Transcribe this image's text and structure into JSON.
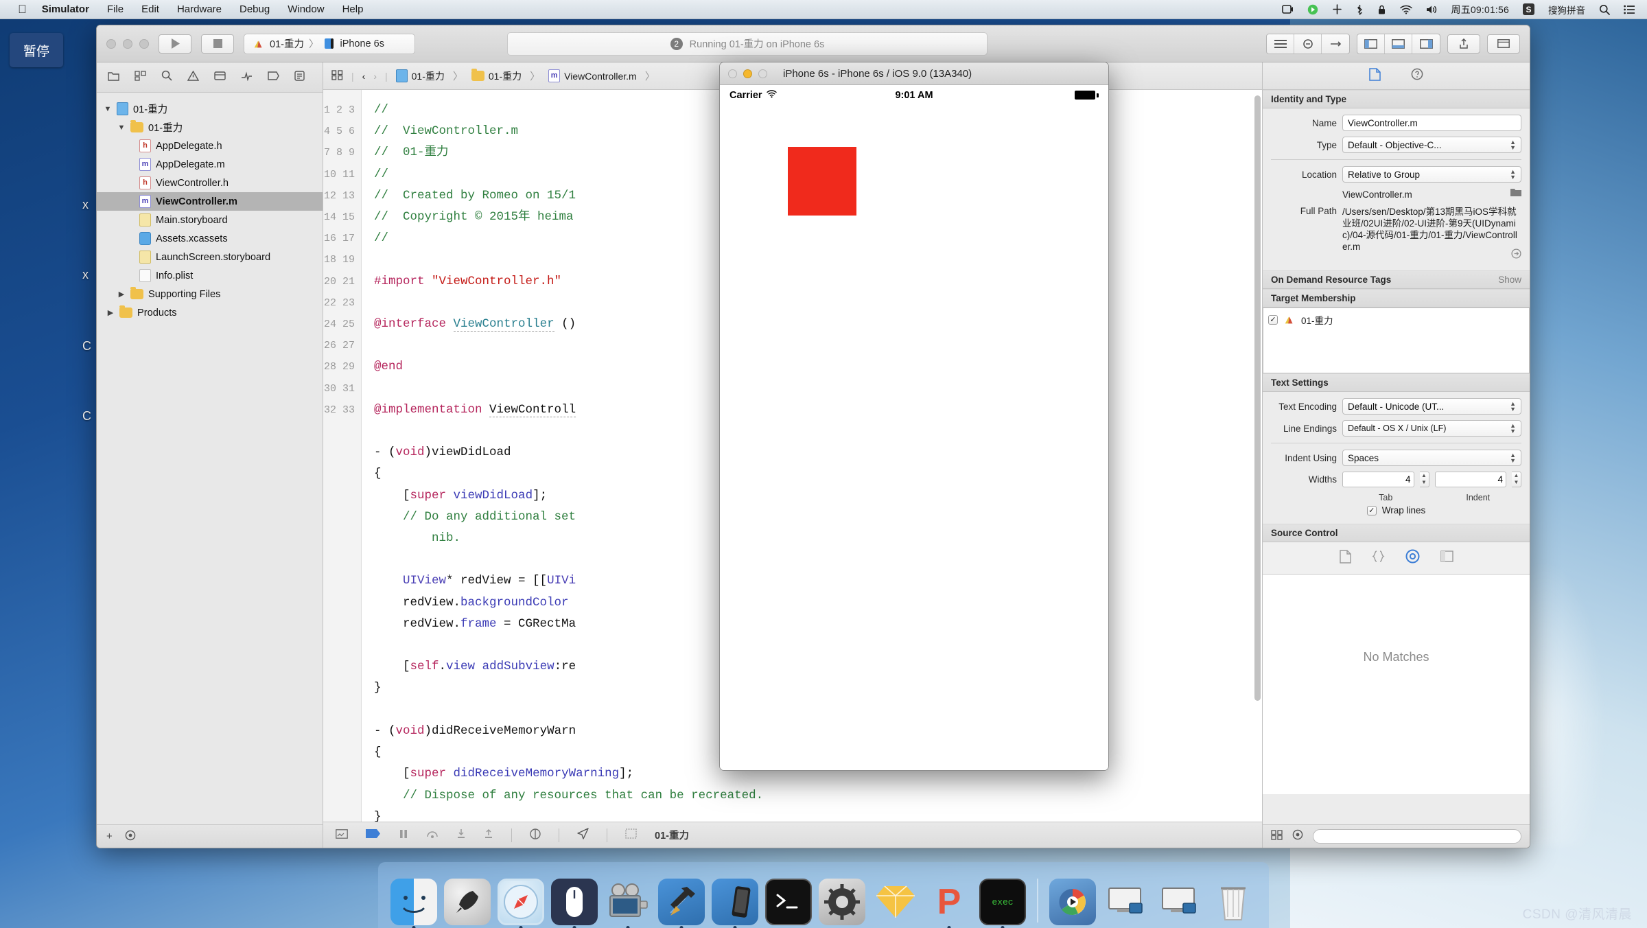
{
  "menubar": {
    "apple": "apple-logo",
    "items": [
      "Simulator",
      "File",
      "Edit",
      "Hardware",
      "Debug",
      "Window",
      "Help"
    ],
    "status": {
      "clock": "周五09:01:56",
      "input_method_badge": "S",
      "input_method": "搜狗拼音",
      "icons": [
        "screen-record-icon",
        "play-green-icon",
        "airplay-icon",
        "bluetooth-icon",
        "lock-icon",
        "wifi-icon",
        "volume-icon",
        "spotlight-search-icon",
        "notification-center-icon"
      ]
    }
  },
  "overlay": {
    "pause_button": "暂停"
  },
  "desktop": {
    "icon_letters": [
      "x",
      "x",
      "C",
      "C"
    ]
  },
  "xcode": {
    "toolbar": {
      "run_label": "run-button",
      "stop_label": "stop-button",
      "scheme_project": "01-重力",
      "scheme_sep": "〉",
      "scheme_device": "iPhone 6s",
      "activity_badge": "2",
      "activity_text": "Running 01-重力 on iPhone 6s"
    },
    "navigator": {
      "items": [
        {
          "label": "01-重力",
          "icon": "project-icon",
          "indent": 0,
          "twisty": "▼",
          "selected": false
        },
        {
          "label": "01-重力",
          "icon": "folder-icon",
          "indent": 1,
          "twisty": "▼",
          "selected": false
        },
        {
          "label": "AppDelegate.h",
          "icon": "header-file-icon",
          "indent": 2,
          "twisty": "",
          "selected": false
        },
        {
          "label": "AppDelegate.m",
          "icon": "objc-file-icon",
          "indent": 2,
          "twisty": "",
          "selected": false
        },
        {
          "label": "ViewController.h",
          "icon": "header-file-icon",
          "indent": 2,
          "twisty": "",
          "selected": false
        },
        {
          "label": "ViewController.m",
          "icon": "objc-file-icon",
          "indent": 2,
          "twisty": "",
          "selected": true
        },
        {
          "label": "Main.storyboard",
          "icon": "storyboard-icon",
          "indent": 2,
          "twisty": "",
          "selected": false
        },
        {
          "label": "Assets.xcassets",
          "icon": "xcassets-icon",
          "indent": 2,
          "twisty": "",
          "selected": false
        },
        {
          "label": "LaunchScreen.storyboard",
          "icon": "storyboard-icon",
          "indent": 2,
          "twisty": "",
          "selected": false
        },
        {
          "label": "Info.plist",
          "icon": "plist-icon",
          "indent": 2,
          "twisty": "",
          "selected": false
        },
        {
          "label": "Supporting Files",
          "icon": "folder-icon",
          "indent": 1,
          "twisty": "▶",
          "selected": false
        },
        {
          "label": "Products",
          "icon": "folder-icon",
          "indent": 0,
          "twisty": "▶",
          "selected": false
        }
      ]
    },
    "jumpbar": {
      "project": "01-重力",
      "group": "01-重力",
      "file": "ViewController.m",
      "sep": "〉"
    },
    "code": {
      "first_line": 1,
      "last_line": 33,
      "lines": [
        "//",
        "//  ViewController.m",
        "//  01-重力",
        "//",
        "//  Created by Romeo on 15/1",
        "//  Copyright © 2015年 heima",
        "//",
        "",
        "#import \"ViewController.h\"",
        "",
        "@interface ViewController ()",
        "",
        "@end",
        "",
        "@implementation ViewControll",
        "",
        "- (void)viewDidLoad",
        "{",
        "    [super viewDidLoad];",
        "    // Do any additional set                              ly from a",
        "        nib.",
        "",
        "    UIView* redView = [[UIVi",
        "    redView.backgroundColor",
        "    redView.frame = CGRectMa",
        "",
        "    [self.view addSubview:re",
        "}",
        "",
        "- (void)didReceiveMemoryWarn",
        "{",
        "    [super didReceiveMemoryWarning];",
        "    // Dispose of any resources that can be recreated.",
        "}"
      ]
    },
    "debugbar": {
      "scheme": "01-重力",
      "icons": [
        "show-debug-area-icon",
        "breakpoint-icon",
        "pause-icon",
        "step-over-icon",
        "step-into-icon",
        "step-out-icon",
        "view-hierarchy-icon",
        "location-simulate-icon",
        "memory-graph-icon"
      ]
    },
    "inspector": {
      "tabs": [
        "file-inspector-icon",
        "quick-help-icon"
      ],
      "identity": {
        "header": "Identity and Type",
        "name_label": "Name",
        "name_value": "ViewController.m",
        "type_label": "Type",
        "type_value": "Default - Objective-C...",
        "location_label": "Location",
        "location_value": "Relative to Group",
        "location_file": "ViewController.m",
        "fullpath_label": "Full Path",
        "fullpath_value": "/Users/sen/Desktop/第13期黑马iOS学科就业班/02UI进阶/02-UI进阶-第9天(UIDynamic)/04-源代码/01-重力/01-重力/ViewController.m"
      },
      "ondemand": {
        "header": "On Demand Resource Tags",
        "show": "Show"
      },
      "target_membership": {
        "header": "Target Membership",
        "item": "01-重力",
        "checked": true
      },
      "text_settings": {
        "header": "Text Settings",
        "encoding_label": "Text Encoding",
        "encoding_value": "Default - Unicode (UT...",
        "endings_label": "Line Endings",
        "endings_value": "Default - OS X / Unix (LF)",
        "indent_label": "Indent Using",
        "indent_value": "Spaces",
        "widths_label": "Widths",
        "tab_value": "4",
        "indent_value_num": "4",
        "tab_caption": "Tab",
        "indent_caption": "Indent",
        "wrap_label": "Wrap lines",
        "wrap_checked": true
      },
      "source_control": {
        "header": "Source Control",
        "icons": [
          "file-icon",
          "braces-icon",
          "target-icon",
          "split-icon"
        ],
        "empty_text": "No Matches"
      }
    }
  },
  "simulator": {
    "title": "iPhone 6s - iPhone 6s / iOS 9.0 (13A340)",
    "status": {
      "carrier": "Carrier",
      "wifi": "wifi-icon",
      "time": "9:01 AM",
      "battery": "battery-full-icon"
    },
    "red_view_color": "#f02a1c"
  },
  "dock": {
    "items": [
      {
        "name": "finder",
        "glyph": "finder-icon",
        "running": true
      },
      {
        "name": "launchpad",
        "glyph": "rocket-icon",
        "running": false
      },
      {
        "name": "safari",
        "glyph": "compass-icon",
        "running": true
      },
      {
        "name": "mouse-app",
        "glyph": "mouse-icon",
        "running": true
      },
      {
        "name": "quicktime",
        "glyph": "movie-camera-icon",
        "running": true
      },
      {
        "name": "xcode",
        "glyph": "hammer-blueprint-icon",
        "running": true
      },
      {
        "name": "simulator",
        "glyph": "iphone-blueprint-icon",
        "running": true
      },
      {
        "name": "terminal",
        "glyph": "terminal-prompt-icon",
        "running": false
      },
      {
        "name": "system-preferences",
        "glyph": "gear-icon",
        "running": false
      },
      {
        "name": "sketch",
        "glyph": "diamond-icon",
        "running": false
      },
      {
        "name": "p-app",
        "glyph": "p-letter-icon",
        "running": true
      },
      {
        "name": "exec-app",
        "glyph": "exec-terminal-icon",
        "running": true
      },
      {
        "name": "separator",
        "glyph": "dock-separator",
        "running": false
      },
      {
        "name": "media-player",
        "glyph": "media-wheel-icon",
        "running": false
      },
      {
        "name": "downloads-1",
        "glyph": "screen-stack-icon",
        "running": false
      },
      {
        "name": "downloads-2",
        "glyph": "screen-stack-icon",
        "running": false
      },
      {
        "name": "trash",
        "glyph": "trash-icon",
        "running": false
      }
    ]
  },
  "watermark": "CSDN @清风清晨"
}
